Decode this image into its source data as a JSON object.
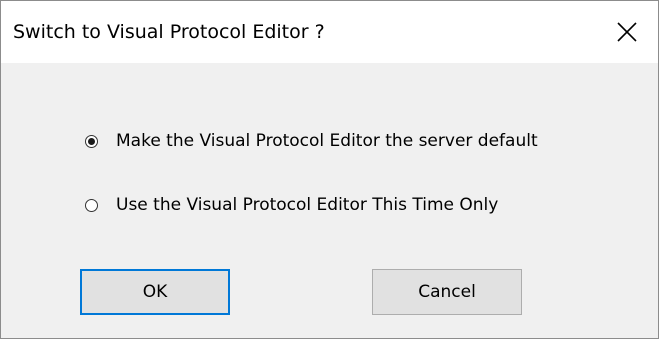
{
  "dialog": {
    "title": "Switch to Visual Protocol Editor ?",
    "close_icon": "close-icon"
  },
  "options": [
    {
      "label": "Make the Visual Protocol Editor the server default",
      "selected": true
    },
    {
      "label": "Use the Visual Protocol Editor This Time Only",
      "selected": false
    }
  ],
  "buttons": {
    "ok_label": "OK",
    "cancel_label": "Cancel"
  },
  "colors": {
    "dialog_bg": "#f0f0f0",
    "titlebar_bg": "#ffffff",
    "button_bg": "#e1e1e1",
    "default_button_border": "#0078d7"
  }
}
